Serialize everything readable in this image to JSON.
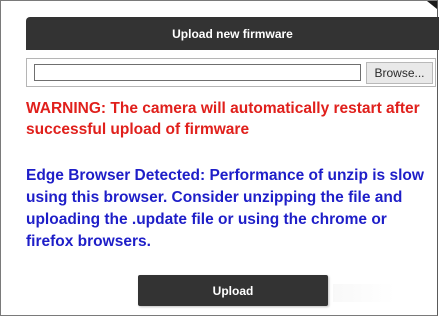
{
  "header": {
    "title": "Upload new firmware"
  },
  "file_picker": {
    "path_value": "",
    "browse_label": "Browse..."
  },
  "messages": {
    "warning": "WARNING: The camera will automatically restart after successful upload of firmware",
    "edge_note": "Edge Browser Detected: Performance of unzip is slow using this browser. Consider unzipping the file and uploading the .update file or using the chrome or firefox browsers."
  },
  "actions": {
    "upload_label": "Upload"
  },
  "colors": {
    "header_bg": "#333333",
    "warning_text": "#e0201c",
    "info_text": "#1e1ec8",
    "button_bg": "#333333"
  }
}
